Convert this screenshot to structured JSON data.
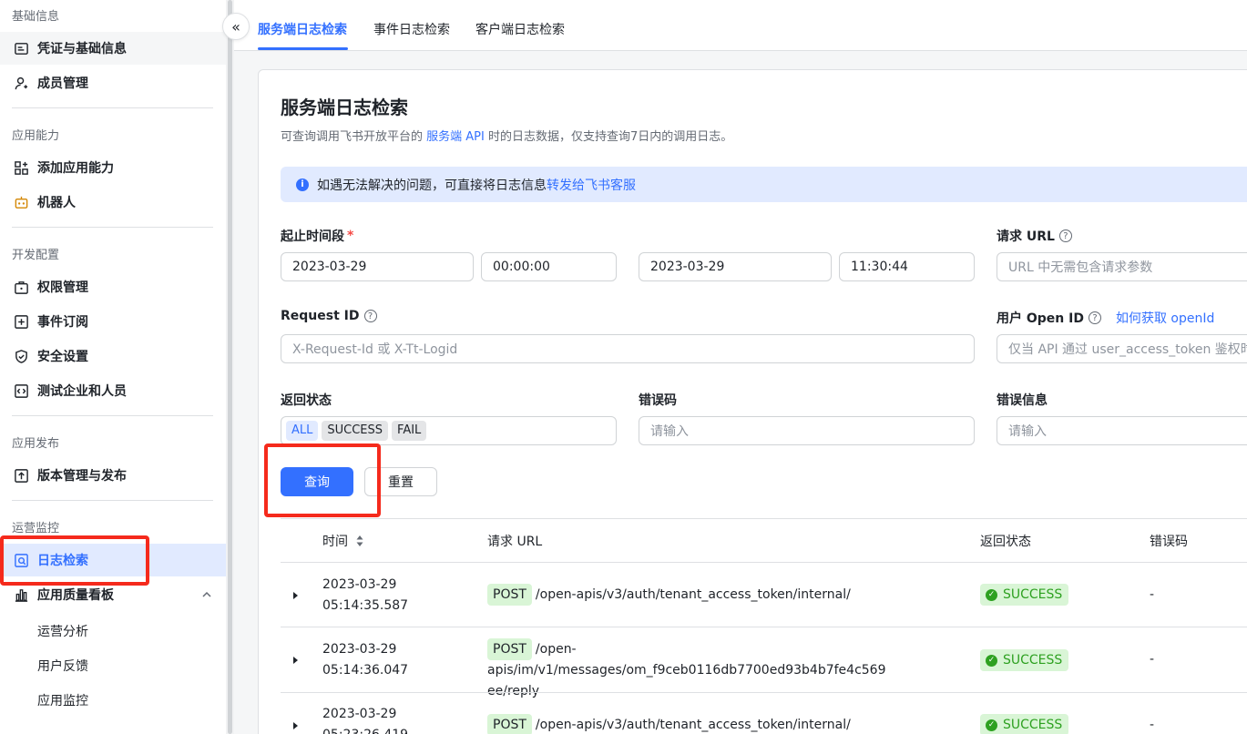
{
  "sidebar": {
    "groups": {
      "basic": "基础信息",
      "ability": "应用能力",
      "dev": "开发配置",
      "release": "应用发布",
      "ops": "运营监控"
    },
    "items": {
      "credentials": "凭证与基础信息",
      "members": "成员管理",
      "add_ability": "添加应用能力",
      "robot": "机器人",
      "permissions": "权限管理",
      "events": "事件订阅",
      "security": "安全设置",
      "test_org": "测试企业和人员",
      "versions": "版本管理与发布",
      "log_search": "日志检索",
      "quality": "应用质量看板"
    },
    "subitems": {
      "ops_analysis": "运营分析",
      "feedback": "用户反馈",
      "monitor": "应用监控"
    }
  },
  "tabs": {
    "server": "服务端日志检索",
    "event": "事件日志检索",
    "client": "客户端日志检索"
  },
  "page": {
    "title": "服务端日志检索",
    "desc_pre": "可查询调用飞书开放平台的 ",
    "desc_link": "服务端 API",
    "desc_post": " 时的日志数据，仅支持查询7日内的调用日志。",
    "notice_text": "如遇无法解决的问题，可直接将日志信息 ",
    "notice_link": "转发给飞书客服"
  },
  "form": {
    "time_label": "起止时间段",
    "required_mark": "*",
    "start_date": "2023-03-29",
    "start_time": "00:00:00",
    "end_date": "2023-03-29",
    "end_time": "11:30:44",
    "url_label": "请求 URL",
    "url_placeholder": "URL 中无需包含请求参数",
    "request_id_label": "Request ID",
    "request_id_placeholder": "X-Request-Id 或 X-Tt-Logid",
    "open_id_label": "用户 Open ID",
    "open_id_link": "如何获取 openId",
    "open_id_placeholder": "仅当 API 通过 user_access_token 鉴权时可",
    "status_label": "返回状态",
    "status_options": [
      "ALL",
      "SUCCESS",
      "FAIL"
    ],
    "error_code_label": "错误码",
    "error_code_placeholder": "请输入",
    "error_msg_label": "错误信息",
    "error_msg_placeholder": "请输入",
    "query_button": "查询",
    "reset_button": "重置"
  },
  "table": {
    "headers": {
      "time": "时间",
      "url": "请求 URL",
      "status": "返回状态",
      "error_code": "错误码"
    },
    "rows": [
      {
        "date": "2023-03-29",
        "time": "05:14:35.587",
        "method": "POST",
        "url_line1": "/open-apis/v3/auth/tenant_access_token/internal/",
        "url_line2": "",
        "status": "SUCCESS",
        "error_code": "-"
      },
      {
        "date": "2023-03-29",
        "time": "05:14:36.047",
        "method": "POST",
        "url_line1": "/open-apis/im/v1/messages/om_f9ceb0116db7700ed93b4b7fe4c569",
        "url_line2": "ee/reply",
        "status": "SUCCESS",
        "error_code": "-"
      },
      {
        "date": "2023-03-29",
        "time": "05:23:26.419",
        "method": "POST",
        "url_line1": "/open-apis/v3/auth/tenant_access_token/internal/",
        "url_line2": "",
        "status": "SUCCESS",
        "error_code": "-"
      }
    ]
  },
  "colors": {
    "accent": "#3370ff",
    "success": "#2ea121",
    "highlight": "#f52a1c"
  }
}
